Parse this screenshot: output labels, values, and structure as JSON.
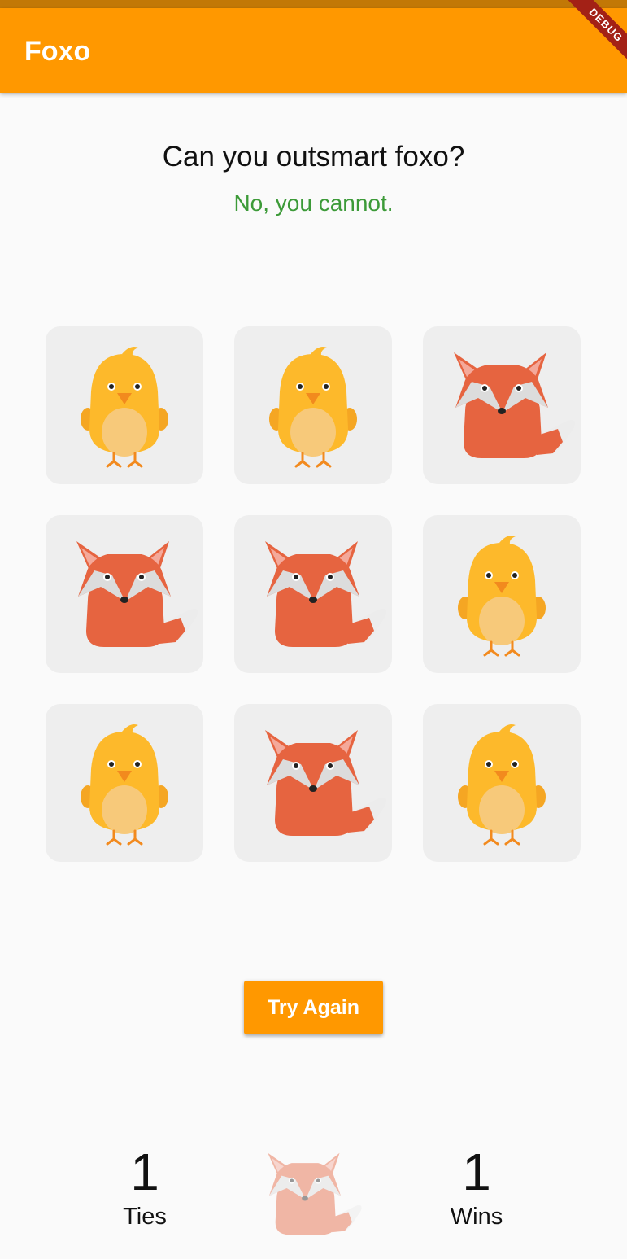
{
  "app_bar": {
    "title": "Foxo",
    "debug_banner": "DEBUG"
  },
  "game": {
    "heading": "Can you outsmart foxo?",
    "result": "No, you cannot.",
    "board": [
      "chick",
      "chick",
      "fox",
      "fox",
      "fox",
      "chick",
      "chick",
      "fox",
      "chick"
    ]
  },
  "actions": {
    "try_again": "Try Again"
  },
  "scoreboard": {
    "ties_value": "1",
    "ties_label": "Ties",
    "wins_value": "1",
    "wins_label": "Wins"
  },
  "colors": {
    "primary": "#ff9800",
    "status_bar": "#c27806",
    "result_text": "#3c9a38",
    "cell_background": "#eeeeee",
    "fox_body": "#e66440",
    "chick_body": "#fdb92b"
  }
}
